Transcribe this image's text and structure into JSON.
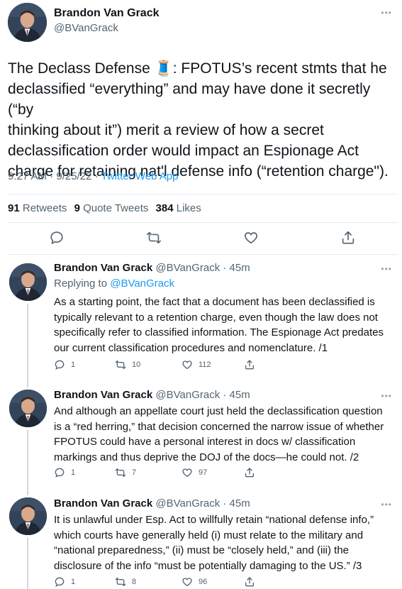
{
  "main_tweet": {
    "author_name": "Brandon Van Grack",
    "author_handle": "@BVanGrack",
    "more_icon": "more-horizontal-icon",
    "text_lines": [
      "The Declass Defense 🧵: FPOTUS’s recent stmts that he",
      "declassified “everything” and may have done it secretly (“by",
      "thinking about it”) merit a review of how a secret",
      "declassification order would impact an Espionage Act",
      "charge for retaining nat'l defense info (“retention charge\")."
    ],
    "time": "9:27 AM · 9/25/22 · ",
    "app": "Twitter Web App",
    "stats": {
      "retweets_count": "91",
      "retweets_label": "Retweets",
      "quotes_count": "9",
      "quotes_label": "Quote Tweets",
      "likes_count": "384",
      "likes_label": "Likes"
    },
    "actions": [
      "reply-icon",
      "retweet-icon",
      "like-icon",
      "share-icon"
    ]
  },
  "replies": [
    {
      "author_name": "Brandon Van Grack",
      "handle_time": "@BVanGrack · 45m",
      "replying_prefix": "Replying to ",
      "replying_to": "@BVanGrack",
      "text_lines": [
        "As a starting point, the fact that a document has been declassified is",
        "typically relevant to a retention charge, even though the law does not",
        "specifically refer to classified information. The Espionage Act predates",
        "our current classification procedures and nomenclature. /1"
      ],
      "replies_count": "1",
      "retweets_count": "10",
      "likes_count": "112"
    },
    {
      "author_name": "Brandon Van Grack",
      "handle_time": "@BVanGrack · 45m",
      "text_lines": [
        "And although an appellate court just held the declassification question",
        "is a “red herring,” that decision concerned the narrow issue of whether",
        "FPOTUS could have a personal interest in docs w/ classification",
        "markings and thus deprive the DOJ of the docs—he could not. /2"
      ],
      "replies_count": "1",
      "retweets_count": "7",
      "likes_count": "97"
    },
    {
      "author_name": "Brandon Van Grack",
      "handle_time": "@BVanGrack · 45m",
      "text_lines": [
        "It is unlawful under Esp. Act to willfully retain “national defense info,”",
        "which courts have generally held (i) must relate to the military and",
        "“national preparedness,” (ii) must be “closely held,” and (iii) the",
        "disclosure of the info “must be potentially damaging to the US.” /3"
      ],
      "replies_count": "1",
      "retweets_count": "8",
      "likes_count": "96"
    }
  ],
  "colors": {
    "accent": "#1d9bf0",
    "text": "#0f1419",
    "secondary": "#536471",
    "divider": "#e6ecf0",
    "thread_line": "#cfd9de"
  }
}
